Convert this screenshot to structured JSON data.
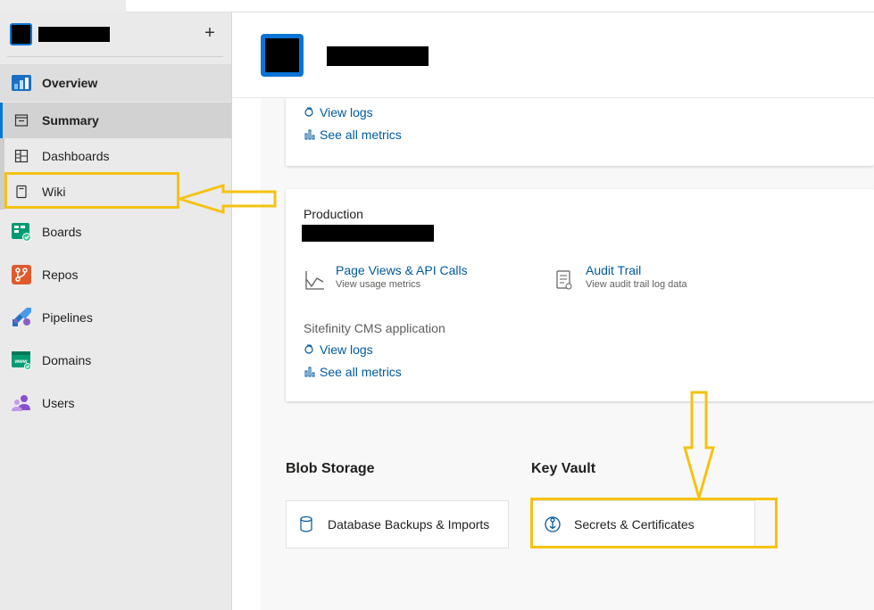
{
  "sidebar": {
    "add_label": "+",
    "items": [
      {
        "label": "Overview",
        "icon": "overview-icon"
      },
      {
        "label": "Summary",
        "icon": "summary-icon"
      },
      {
        "label": "Dashboards",
        "icon": "dashboards-icon"
      },
      {
        "label": "Wiki",
        "icon": "wiki-icon"
      },
      {
        "label": "Boards",
        "icon": "boards-icon"
      },
      {
        "label": "Repos",
        "icon": "repos-icon"
      },
      {
        "label": "Pipelines",
        "icon": "pipelines-icon"
      },
      {
        "label": "Domains",
        "icon": "domains-icon"
      },
      {
        "label": "Users",
        "icon": "users-icon"
      }
    ]
  },
  "card1": {
    "view_logs": "View logs",
    "see_all_metrics": "See all metrics"
  },
  "card2": {
    "title": "Production",
    "page_views": {
      "title": "Page Views & API Calls",
      "subtitle": "View usage metrics"
    },
    "audit_trail": {
      "title": "Audit Trail",
      "subtitle": "View audit trail log data"
    },
    "app_title": "Sitefinity CMS application",
    "view_logs": "View logs",
    "see_all_metrics": "See all metrics"
  },
  "blob_storage": {
    "title": "Blob Storage",
    "tile": "Database Backups & Imports"
  },
  "key_vault": {
    "title": "Key Vault",
    "tile": "Secrets & Certificates"
  },
  "colors": {
    "accent": "#0078d4",
    "link": "#005a9e",
    "annotation": "#f5c211"
  }
}
